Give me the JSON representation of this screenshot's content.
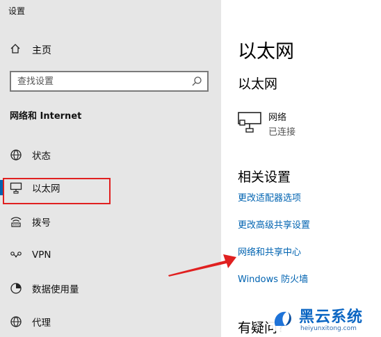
{
  "window": {
    "title": "设置"
  },
  "sidebar": {
    "home_label": "主页",
    "search_placeholder": "查找设置",
    "section_title": "网络和 Internet",
    "items": [
      {
        "label": "状态",
        "icon": "globe-status-icon"
      },
      {
        "label": "以太网",
        "icon": "ethernet-icon",
        "active": true
      },
      {
        "label": "拨号",
        "icon": "dialup-icon"
      },
      {
        "label": "VPN",
        "icon": "vpn-icon"
      },
      {
        "label": "数据使用量",
        "icon": "data-usage-icon"
      },
      {
        "label": "代理",
        "icon": "proxy-globe-icon"
      }
    ]
  },
  "main": {
    "title": "以太网",
    "subtitle": "以太网",
    "connection": {
      "name": "网络",
      "status": "已连接"
    },
    "related_title": "相关设置",
    "links": [
      "更改适配器选项",
      "更改高级共享设置",
      "网络和共享中心",
      "Windows 防火墙"
    ],
    "question_title": "有疑问?"
  },
  "watermark": {
    "main": "黑云系统",
    "url": "heiyunxitong.com"
  },
  "colors": {
    "accent": "#0063b1",
    "sidebar_bg": "#e6e6e6",
    "highlight": "#e02020"
  }
}
